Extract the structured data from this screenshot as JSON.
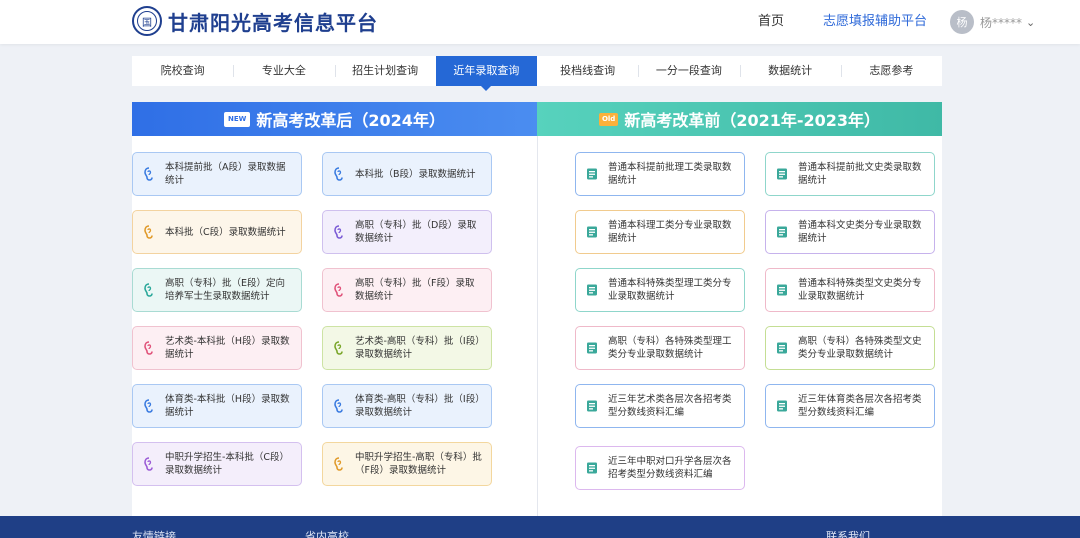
{
  "site": {
    "title": "甘肃阳光高考信息平台",
    "seal_char": "国"
  },
  "topnav": {
    "home": "首页",
    "platform": "志愿填报辅助平台"
  },
  "user": {
    "avatar_char": "杨",
    "name": "杨*****"
  },
  "menu": [
    "院校查询",
    "专业大全",
    "招生计划查询",
    "近年录取查询",
    "投档线查询",
    "一分一段查询",
    "数据统计",
    "志愿参考"
  ],
  "active_menu": "近年录取查询",
  "sections": {
    "after": {
      "badge": "NEW",
      "title": "新高考改革后（2024年）"
    },
    "before": {
      "badge": "Old",
      "title": "新高考改革前（2021年-2023年）"
    }
  },
  "after_cards": [
    {
      "label": "本科提前批（A段）录取数据统计",
      "color": "#3a7be0"
    },
    {
      "label": "本科批（B段）录取数据统计",
      "color": "#3a7be0"
    },
    {
      "label": "本科批（C段）录取数据统计",
      "color": "#e09a2a"
    },
    {
      "label": "高职（专科）批（D段）录取数据统计",
      "color": "#7b5bd6"
    },
    {
      "label": "高职（专科）批（E段）定向培养军士生录取数据统计",
      "color": "#2aa89a"
    },
    {
      "label": "高职（专科）批（F段）录取数据统计",
      "color": "#e0537a"
    },
    {
      "label": "艺术类-本科批（H段）录取数据统计",
      "color": "#e0537a"
    },
    {
      "label": "艺术类-高职（专科）批（I段）录取数据统计",
      "color": "#7aa62a"
    },
    {
      "label": "体育类-本科批（H段）录取数据统计",
      "color": "#3a7be0"
    },
    {
      "label": "体育类-高职（专科）批（I段）录取数据统计",
      "color": "#3a7be0"
    },
    {
      "label": "中职升学招生-本科批（C段）录取数据统计",
      "color": "#9b5bd6"
    },
    {
      "label": "中职升学招生-高职（专科）批（F段）录取数据统计",
      "color": "#e09a2a"
    }
  ],
  "before_cards": [
    {
      "label": "普通本科提前批理工类录取数据统计",
      "color": "#3aa89a"
    },
    {
      "label": "普通本科提前批文史类录取数据统计",
      "color": "#3aa89a"
    },
    {
      "label": "普通本科理工类分专业录取数据统计",
      "color": "#3aa89a"
    },
    {
      "label": "普通本科文史类分专业录取数据统计",
      "color": "#3aa89a"
    },
    {
      "label": "普通本科特殊类型理工类分专业录取数据统计",
      "color": "#3aa89a"
    },
    {
      "label": "普通本科特殊类型文史类分专业录取数据统计",
      "color": "#3aa89a"
    },
    {
      "label": "高职（专科）各特殊类型理工类分专业录取数据统计",
      "color": "#3aa89a"
    },
    {
      "label": "高职（专科）各特殊类型文史类分专业录取数据统计",
      "color": "#3aa89a"
    },
    {
      "label": "近三年艺术类各层次各招考类型分数线资料汇编",
      "color": "#3aa89a"
    },
    {
      "label": "近三年体育类各层次各招考类型分数线资料汇编",
      "color": "#3aa89a"
    },
    {
      "label": "近三年中职对口升学各层次各招考类型分数线资料汇编",
      "color": "#3aa89a"
    }
  ],
  "footer": {
    "links": "友情链接",
    "schools": "省内高校",
    "contact": "联系我们"
  }
}
